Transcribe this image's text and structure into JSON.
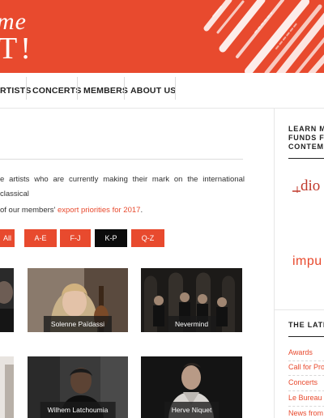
{
  "header": {
    "logo_top": "me",
    "logo_bottom": "T!"
  },
  "nav": {
    "items": [
      "RTISTS",
      "CONCERTS",
      "MEMBERS",
      "ABOUT US"
    ]
  },
  "intro": {
    "text": "e artists who are currently making their mark on the international classical",
    "export_prefix": "of our members' ",
    "export_link": "export priorities for 2017",
    "export_suffix": "."
  },
  "filters": [
    "All",
    "A-E",
    "F-J",
    "K-P",
    "Q-Z"
  ],
  "active_filter": "K-P",
  "artists": [
    {
      "name": "Solenne Païdassi"
    },
    {
      "name": "Nevermind"
    },
    {
      "name": "Wilhem Latchoumia"
    },
    {
      "name": "Herve Niquet"
    }
  ],
  "sidebar": {
    "learn_heading": [
      "LEARN M",
      "FUNDS F",
      "CONTEM"
    ],
    "partner_1": "dio",
    "partner_2": "impu",
    "latest_heading": "THE LATE",
    "links": [
      "Awards",
      "Call for Pro",
      "Concerts",
      "Le Bureau E",
      "News from"
    ]
  },
  "colors": {
    "accent": "#e84a2e",
    "active_filter": "#0b0b0b",
    "caption_bg": "#191919"
  }
}
